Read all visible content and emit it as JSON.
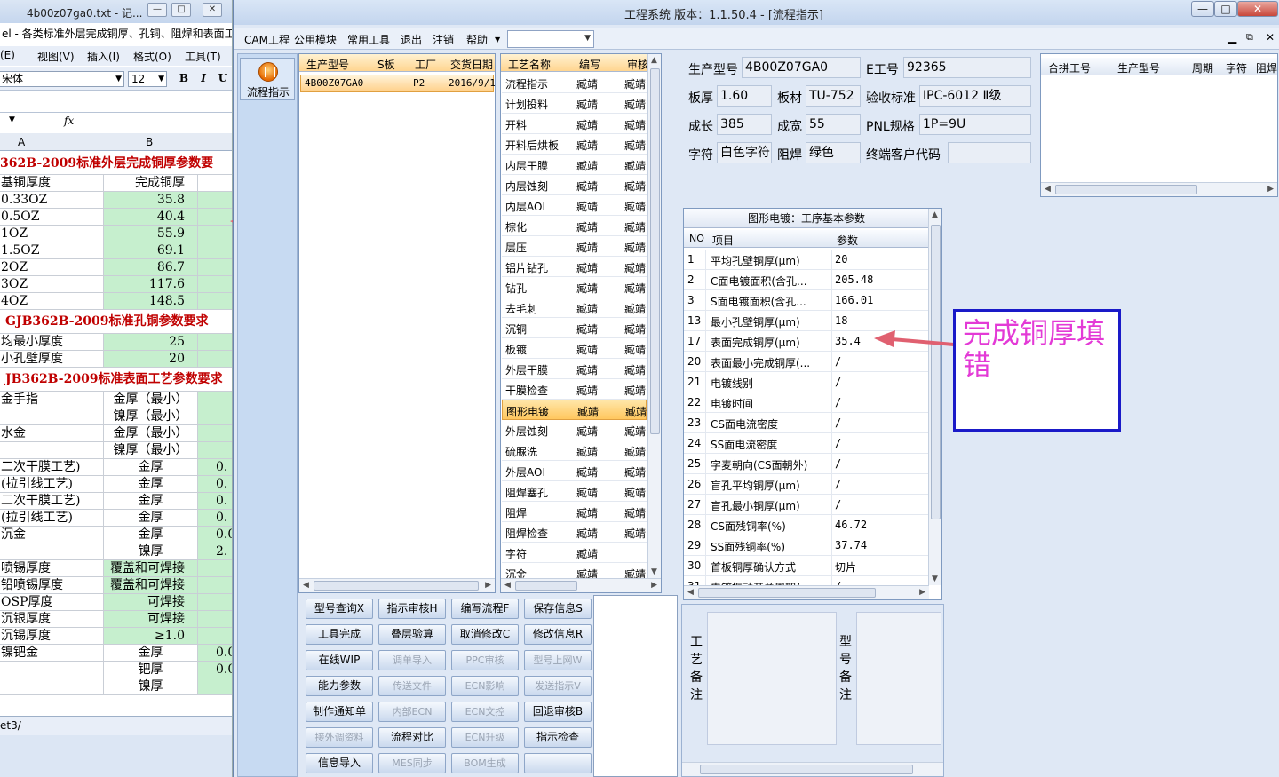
{
  "excel": {
    "title": "4b00z07ga0.txt - 记...",
    "subtitle": "el - 各类标准外层完成铜厚、孔铜、阻焊和表面工",
    "menu": [
      "视图(V)",
      "插入(I)",
      "格式(O)",
      "工具(T)"
    ],
    "menu_first": "(E)",
    "font_name": "宋体",
    "font_size": "12",
    "bold": "B",
    "italic": "I",
    "underline": "U",
    "fx": "fx",
    "col_a": "A",
    "col_b": "B",
    "rows": [
      {
        "a": "362B-2009标准外层完成铜厚参数要",
        "b": "",
        "type": "title"
      },
      {
        "a": "基铜厚度",
        "b": "完成铜厚",
        "type": "header"
      },
      {
        "a": "0.33OZ",
        "b": "35.8",
        "type": "data"
      },
      {
        "a": "0.5OZ",
        "b": "40.4",
        "type": "data"
      },
      {
        "a": "1OZ",
        "b": "55.9",
        "type": "data"
      },
      {
        "a": "1.5OZ",
        "b": "69.1",
        "type": "data"
      },
      {
        "a": "2OZ",
        "b": "86.7",
        "type": "data"
      },
      {
        "a": "3OZ",
        "b": "117.6",
        "type": "data"
      },
      {
        "a": "4OZ",
        "b": "148.5",
        "type": "data"
      },
      {
        "a": "GJB362B-2009标准孔铜参数要求",
        "b": "",
        "type": "title"
      },
      {
        "a": "均最小厚度",
        "b": "25",
        "type": "data"
      },
      {
        "a": "小孔壁厚度",
        "b": "20",
        "type": "data"
      },
      {
        "a": "JB362B-2009标准表面工艺参数要求",
        "b": "",
        "type": "title"
      },
      {
        "a": "金手指",
        "b": "金厚（最小）",
        "c": "",
        "type": "sub"
      },
      {
        "a": "",
        "b": "镍厚（最小）",
        "c": "",
        "type": "sub"
      },
      {
        "a": "水金",
        "b": "金厚（最小）",
        "c": "",
        "type": "sub"
      },
      {
        "a": "",
        "b": "镍厚（最小）",
        "c": "",
        "type": "sub"
      },
      {
        "a": "二次干膜工艺)",
        "b": "金厚",
        "c": "0.",
        "type": "sub"
      },
      {
        "a": "(拉引线工艺)",
        "b": "金厚",
        "c": "0.",
        "type": "sub"
      },
      {
        "a": "二次干膜工艺)",
        "b": "金厚",
        "c": "0.",
        "type": "sub"
      },
      {
        "a": "(拉引线工艺)",
        "b": "金厚",
        "c": "0.",
        "type": "sub"
      },
      {
        "a": "沉金",
        "b": "金厚",
        "c": "0.0",
        "type": "sub"
      },
      {
        "a": "",
        "b": "镍厚",
        "c": "2.",
        "type": "sub"
      },
      {
        "a": "喷锡厚度",
        "b": "覆盖和可焊接",
        "type": "data"
      },
      {
        "a": "铅喷锡厚度",
        "b": "覆盖和可焊接",
        "type": "data"
      },
      {
        "a": "OSP厚度",
        "b": "可焊接",
        "type": "data"
      },
      {
        "a": "沉银厚度",
        "b": "可焊接",
        "type": "data"
      },
      {
        "a": "沉锡厚度",
        "b": "≥1.0",
        "type": "data"
      },
      {
        "a": "镍钯金",
        "b": "金厚",
        "c": "0.0",
        "type": "sub"
      },
      {
        "a": "",
        "b": "钯厚",
        "c": "0.0",
        "type": "sub"
      },
      {
        "a": "",
        "b": "镍厚",
        "c": "",
        "type": "sub"
      }
    ],
    "sheet_tab": "et3/"
  },
  "app": {
    "title": "工程系统   版本：1.1.50.4 - [流程指示]",
    "win_min": "—",
    "win_max": "□",
    "win_close": "✕",
    "menu": [
      "CAM工程",
      "公用模块",
      "常用工具",
      "退出",
      "注销",
      "帮助"
    ],
    "menu_combo_value": "",
    "flow_button": "流程指示",
    "model_list": {
      "headers": [
        "生产型号",
        "S板",
        "工厂",
        "交货日期"
      ],
      "rows": [
        {
          "model": "4B00Z07GA0",
          "s": "",
          "factory": "P2",
          "date": "2016/9/1"
        }
      ]
    },
    "process_list": {
      "headers": [
        "工艺名称",
        "编写",
        "审核"
      ],
      "selected_index": 16,
      "rows": [
        {
          "name": "流程指示",
          "w": "臧靖",
          "r": "臧靖"
        },
        {
          "name": "计划投料",
          "w": "臧靖",
          "r": "臧靖"
        },
        {
          "name": "开料",
          "w": "臧靖",
          "r": "臧靖"
        },
        {
          "name": "开料后烘板",
          "w": "臧靖",
          "r": "臧靖"
        },
        {
          "name": "内层干膜",
          "w": "臧靖",
          "r": "臧靖"
        },
        {
          "name": "内层蚀刻",
          "w": "臧靖",
          "r": "臧靖"
        },
        {
          "name": "内层AOI",
          "w": "臧靖",
          "r": "臧靖"
        },
        {
          "name": "棕化",
          "w": "臧靖",
          "r": "臧靖"
        },
        {
          "name": "层压",
          "w": "臧靖",
          "r": "臧靖"
        },
        {
          "name": "铝片钻孔",
          "w": "臧靖",
          "r": "臧靖"
        },
        {
          "name": "钻孔",
          "w": "臧靖",
          "r": "臧靖"
        },
        {
          "name": "去毛刺",
          "w": "臧靖",
          "r": "臧靖"
        },
        {
          "name": "沉铜",
          "w": "臧靖",
          "r": "臧靖"
        },
        {
          "name": "板镀",
          "w": "臧靖",
          "r": "臧靖"
        },
        {
          "name": "外层干膜",
          "w": "臧靖",
          "r": "臧靖"
        },
        {
          "name": "干膜检查",
          "w": "臧靖",
          "r": "臧靖"
        },
        {
          "name": "图形电镀",
          "w": "臧靖",
          "r": "臧靖"
        },
        {
          "name": "外层蚀刻",
          "w": "臧靖",
          "r": "臧靖"
        },
        {
          "name": "硫脲洗",
          "w": "臧靖",
          "r": "臧靖"
        },
        {
          "name": "外层AOI",
          "w": "臧靖",
          "r": "臧靖"
        },
        {
          "name": "阻焊塞孔",
          "w": "臧靖",
          "r": "臧靖"
        },
        {
          "name": "阻焊",
          "w": "臧靖",
          "r": "臧靖"
        },
        {
          "name": "阻焊检查",
          "w": "臧靖",
          "r": "臧靖"
        },
        {
          "name": "字符",
          "w": "臧靖",
          "r": ""
        },
        {
          "name": "沉金",
          "w": "臧靖",
          "r": "臧靖"
        }
      ]
    },
    "buttons": [
      [
        "型号查询X",
        "指示审核H",
        "编写流程F",
        "保存信息S"
      ],
      [
        "工具完成",
        "叠层验算",
        "取消修改C",
        "修改信息R"
      ],
      [
        "在线WIP",
        "调单导入",
        "PPC审核",
        "型号上网W"
      ],
      [
        "能力参数",
        "传送文件",
        "ECN影响",
        "发送指示V"
      ],
      [
        "制作通知单",
        "内部ECN",
        "ECN文控",
        "回退审核B"
      ],
      [
        "接外调资料",
        "流程对比",
        "ECN升级",
        "指示检查"
      ],
      [
        "信息导入",
        "MES同步",
        "BOM生成",
        ""
      ]
    ],
    "info": {
      "model_label": "生产型号",
      "model": "4B00Z07GA0",
      "e_label": "E工号",
      "e_no": "92365",
      "thick_label": "板厚",
      "thick": "1.60",
      "mat_label": "板材",
      "mat": "TU-752",
      "std_label": "验收标准",
      "std": "IPC-6012 Ⅱ级",
      "len_label": "成长",
      "len": "385",
      "wid_label": "成宽",
      "wid": "55",
      "pnl_label": "PNL规格",
      "pnl": "1P=9U",
      "char_label": "字符",
      "char": "白色字符",
      "mask_label": "阻焊",
      "mask": "绿色",
      "cust_label": "终端客户代码",
      "cust": ""
    },
    "merge_table": {
      "headers": [
        "合拼工号",
        "生产型号",
        "周期",
        "字符",
        "阻焊"
      ]
    },
    "params": {
      "title": "图形电镀：工序基本参数",
      "headers": [
        "NO",
        "项目",
        "参数"
      ],
      "rows": [
        {
          "no": "1",
          "item": "平均孔壁铜厚(μm)",
          "val": "20"
        },
        {
          "no": "2",
          "item": "C面电镀面积(含孔...",
          "val": "205.48"
        },
        {
          "no": "3",
          "item": "S面电镀面积(含孔...",
          "val": "166.01"
        },
        {
          "no": "13",
          "item": "最小孔壁铜厚(μm)",
          "val": "18"
        },
        {
          "no": "17",
          "item": "表面完成铜厚(μm)",
          "val": "35.4"
        },
        {
          "no": "20",
          "item": "表面最小完成铜厚(...",
          "val": "/"
        },
        {
          "no": "21",
          "item": "电镀线别",
          "val": "/"
        },
        {
          "no": "22",
          "item": "电镀时间",
          "val": "/"
        },
        {
          "no": "23",
          "item": "CS面电流密度",
          "val": "/"
        },
        {
          "no": "24",
          "item": "SS面电流密度",
          "val": "/"
        },
        {
          "no": "25",
          "item": "字麦朝向(CS面朝外)",
          "val": "/"
        },
        {
          "no": "26",
          "item": "盲孔平均铜厚(μm)",
          "val": "/"
        },
        {
          "no": "27",
          "item": "盲孔最小铜厚(μm)",
          "val": "/"
        },
        {
          "no": "28",
          "item": "CS面残铜率(%)",
          "val": "46.72"
        },
        {
          "no": "29",
          "item": "SS面残铜率(%)",
          "val": "37.74"
        },
        {
          "no": "30",
          "item": "首板铜厚确认方式",
          "val": "切片"
        },
        {
          "no": "31",
          "item": "电镀振动开关周期/...",
          "val": "/"
        }
      ]
    },
    "notes": {
      "process_label": "工艺备注",
      "model_label": "型号备注",
      "process_text": "",
      "model_text": ""
    },
    "annotation": "完成铜厚填错"
  },
  "colors": {
    "selection": "#ffc75e",
    "excel_green": "#c6efce",
    "excel_title_red": "#c00000",
    "annotation_text": "#e33ad6",
    "annotation_border": "#1a1ac8",
    "arrow": "#e06070"
  }
}
